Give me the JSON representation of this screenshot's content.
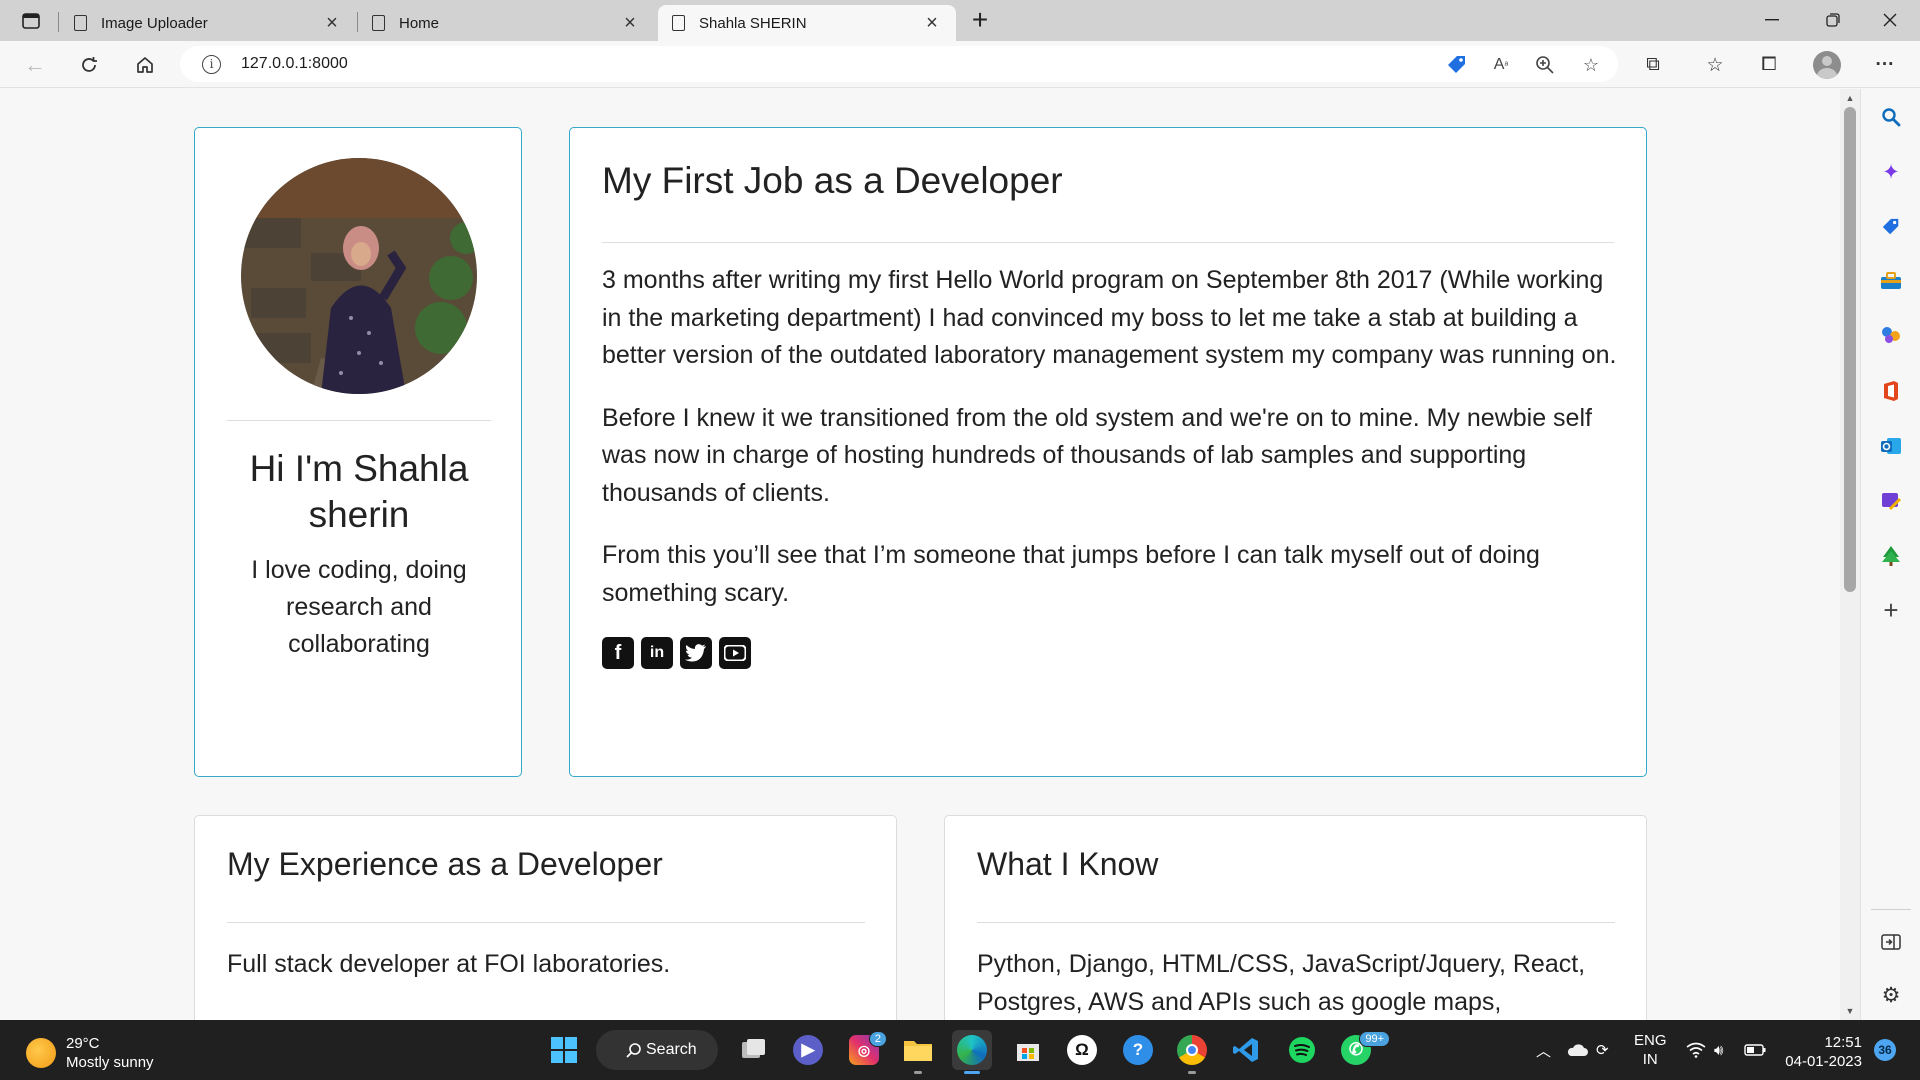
{
  "browser": {
    "tabs": [
      {
        "title": "Image Uploader",
        "active": false
      },
      {
        "title": "Home",
        "active": false
      },
      {
        "title": "Shahla SHERIN",
        "active": true
      }
    ],
    "address": {
      "url": "127.0.0.1:8000"
    },
    "new_tab_label": "+"
  },
  "profile": {
    "name": "Hi I'm Shahla sherin",
    "tagline": "I love coding, doing research and collaborating"
  },
  "story": {
    "heading": "My First Job as a Developer",
    "paragraphs": [
      "3 months after writing my first Hello World program on September 8th 2017 (While working in the marketing department) I had convinced my boss to let me take a stab at building a better version of the outdated laboratory management system my company was running on.",
      "Before I knew it we transitioned from the old system and we're on to mine. My newbie self was now in charge of hosting hundreds of thousands of lab samples and supporting thousands of clients.",
      "From this you’ll see that I’m someone that jumps before I can talk myself out of doing something scary."
    ],
    "socials": [
      "facebook-icon",
      "linkedin-icon",
      "twitter-icon",
      "youtube-icon"
    ]
  },
  "experience": {
    "heading": "My Experience as a Developer",
    "text": "Full stack developer at FOI laboratories."
  },
  "skills": {
    "heading": "What I Know",
    "text": "Python, Django, HTML/CSS, JavaScript/Jquery, React, Postgres, AWS and APIs such as google maps, JavaScript"
  },
  "taskbar": {
    "weather": {
      "temp": "29°C",
      "condition": "Mostly sunny"
    },
    "search_label": "Search",
    "instagram_badge": "2",
    "whatsapp_badge": "99+",
    "language": {
      "lang": "ENG",
      "region": "IN"
    },
    "time": "12:51",
    "date": "04-01-2023",
    "notification_count": "36"
  },
  "colors": {
    "card_border_accent": "#36a9c8",
    "taskbar": "#202020",
    "edge_accent": "#0f6cbd"
  }
}
